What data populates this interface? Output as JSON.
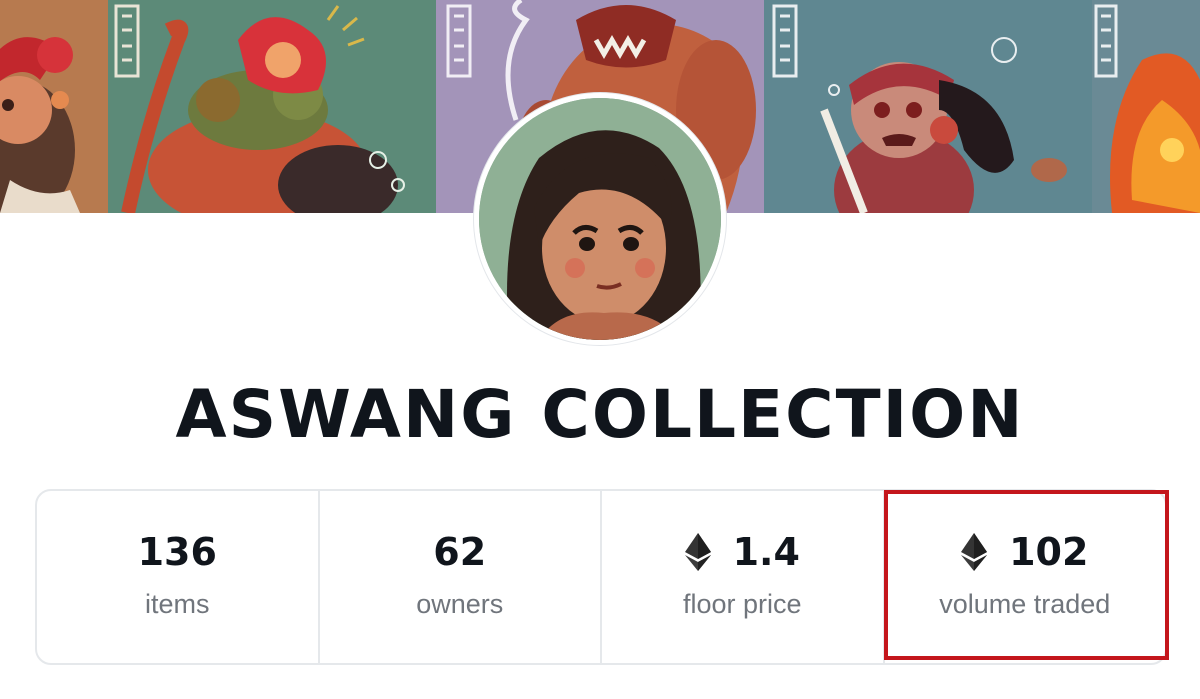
{
  "collection": {
    "title": "ASWANG COLLECTION"
  },
  "stats": [
    {
      "value": "136",
      "label": "items",
      "icon": null
    },
    {
      "value": "62",
      "label": "owners",
      "icon": null
    },
    {
      "value": "1.4",
      "label": "floor price",
      "icon": "ethereum-icon"
    },
    {
      "value": "102",
      "label": "volume traded",
      "icon": "ethereum-icon"
    }
  ],
  "colors": {
    "title": "#10151c",
    "label": "#70757c",
    "border": "#e5e8eb",
    "highlight": "#c4161c"
  }
}
